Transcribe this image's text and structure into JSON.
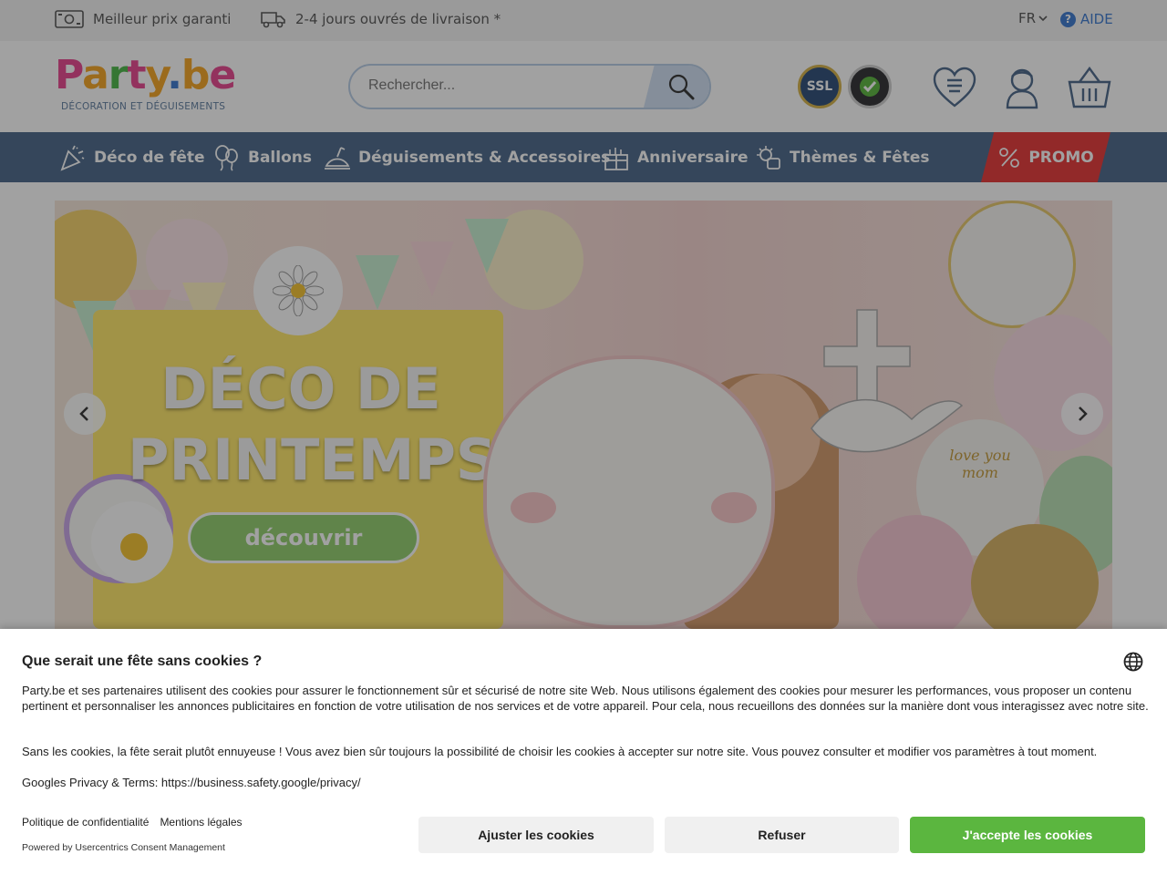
{
  "topbar": {
    "usp1": "Meilleur prix garanti",
    "usp2": "2-4 jours ouvrés de livraison *",
    "language": "FR",
    "help": "AIDE"
  },
  "header": {
    "logo_text": "Party.be",
    "logo_tagline": "DÉCORATION ET DÉGUISEMENTS",
    "search_placeholder": "Rechercher...",
    "ssl_badge": "SSL",
    "icons": [
      "wishlist-icon",
      "account-icon",
      "basket-icon"
    ]
  },
  "nav": {
    "items": [
      {
        "label": "Déco de fête",
        "icon": "party-popper-icon"
      },
      {
        "label": "Ballons",
        "icon": "balloons-icon"
      },
      {
        "label": "Déguisements & Accessoires",
        "icon": "costume-icon"
      },
      {
        "label": "Anniversaire",
        "icon": "gift-icon"
      },
      {
        "label": "Thèmes & Fêtes",
        "icon": "theme-icon"
      }
    ],
    "promo": "PROMO"
  },
  "hero": {
    "title_line1": "DÉCO DE",
    "title_line2": "PRINTEMPS",
    "cta": "découvrir",
    "balloon_text": "love you mom"
  },
  "cookie": {
    "title": "Que serait une fête sans cookies ?",
    "paragraph1": "Party.be et ses partenaires utilisent des cookies pour assurer le fonctionnement sûr et sécurisé de notre site Web. Nous utilisons également des cookies pour mesurer les performances, vous proposer un contenu pertinent et personnaliser les annonces publicitaires en fonction de votre utilisation de nos services et de votre appareil. Pour cela, nous recueillons des données sur la manière dont vous interagissez avec notre site.",
    "paragraph2": "Sans les cookies, la fête serait plutôt ennuyeuse ! Vous avez bien sûr toujours la possibilité de choisir les cookies à accepter sur notre site. Vous pouvez consulter et modifier vos paramètres à tout moment.",
    "paragraph3": "Googles Privacy & Terms: https://business.safety.google/privacy/",
    "link_privacy": "Politique de confidentialité",
    "link_legal": "Mentions légales",
    "powered_by": "Powered by Usercentrics Consent Management",
    "btn_adjust": "Ajuster les cookies",
    "btn_refuse": "Refuser",
    "btn_accept": "J'accepte les cookies"
  },
  "colors": {
    "nav_bg": "#4b688a",
    "promo": "#e63838",
    "accept": "#5bb63f",
    "link_blue": "#3d7bd1"
  }
}
